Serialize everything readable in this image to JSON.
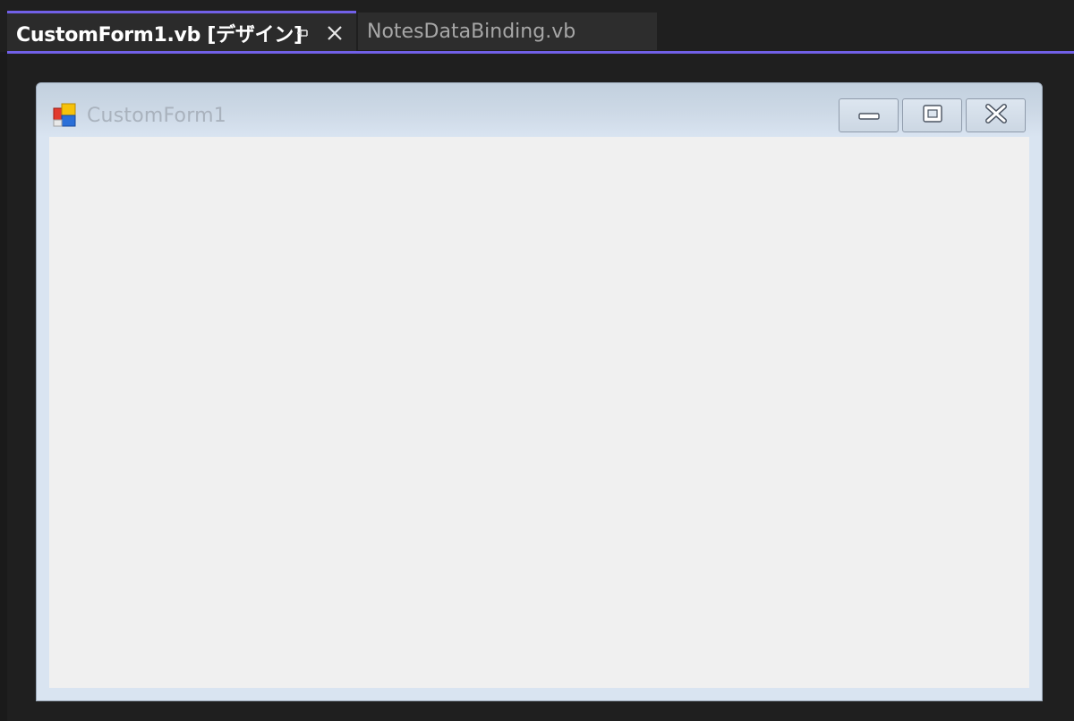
{
  "tabs": {
    "active": {
      "label": "CustomForm1.vb [デザイン]",
      "pin_icon": "pin-icon",
      "close_icon": "close-icon"
    },
    "inactive": {
      "label": "NotesDataBinding.vb"
    }
  },
  "form": {
    "title": "CustomForm1",
    "icon": "form-app-icon",
    "caption_buttons": [
      "minimize-icon",
      "maximize-icon",
      "close-icon"
    ]
  },
  "colors": {
    "accent": "#7160e8",
    "ide_background": "#1f1f1f",
    "form_client": "#f0f0f0",
    "form_border": "#d9e4f1"
  }
}
